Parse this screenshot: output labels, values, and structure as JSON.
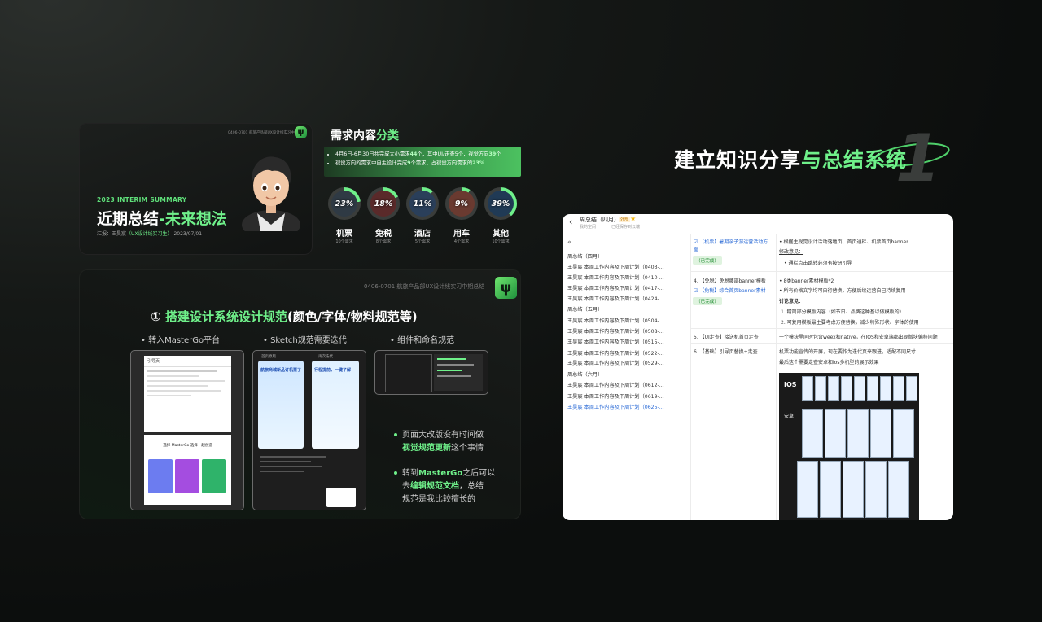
{
  "card1": {
    "small_note": "0406-0701 航旅产品部UX设计线实习中期总结",
    "logo_glyph": "ψ",
    "year_label": "2023 INTERIM SUMMARY",
    "title_main": "近期总结",
    "title_accent": "-未来想法",
    "reporter_prefix": "汇报：王昊宸",
    "reporter_role": "（UX设计线实习生）",
    "reporter_date": "2023/07/01"
  },
  "requirements": {
    "title_main": "需求内容",
    "title_accent": "分类",
    "bullet1_a": "4月6日-6月30日共完成大小需求",
    "bullet1_b": "44",
    "bullet1_c": "个，其中UI/走查5个，视觉方向",
    "bullet1_d": "39",
    "bullet1_e": "个",
    "bullet2_a": "视觉方向的需求中自主设计完成",
    "bullet2_b": "9",
    "bullet2_c": "个需求，占视觉方向需求的",
    "bullet2_d": "23%",
    "categories": [
      {
        "label": "机票",
        "percent": "23%",
        "count": "10个需求",
        "color": "#2f3a44",
        "fill": 0.23
      },
      {
        "label": "免税",
        "percent": "18%",
        "count": "8个需求",
        "color": "#5a2a2a",
        "fill": 0.18
      },
      {
        "label": "酒店",
        "percent": "11%",
        "count": "5个需求",
        "color": "#2a3f5a",
        "fill": 0.11
      },
      {
        "label": "用车",
        "percent": "9%",
        "count": "4个需求",
        "color": "#6a3a30",
        "fill": 0.09
      },
      {
        "label": "其他",
        "percent": "39%",
        "count": "10个需求",
        "color": "#203a55",
        "fill": 0.39
      }
    ]
  },
  "card2": {
    "small_note": "0406-0701 航旅产品部UX设计线实习中期总结",
    "logo_glyph": "ψ",
    "heading_num": "①",
    "heading_green": "搭建设计系统设计规范",
    "heading_rest": "(颜色/字体/物料规范等)",
    "sub1": "• 转入MasterGo平台",
    "sub2": "• Sketch规范需要迭代",
    "sub3": "• 组件和命名规范",
    "shot1_header": "引导页",
    "shot1_banner": "选择 MasterGo 选择一起创造",
    "shot2_tab1": "首页原版",
    "shot2_tab2": "再次迭代",
    "shot2_banner1": "航旅商城新品订机票了",
    "shot2_banner2": "行程提前，一键了解",
    "note1_a": "页面大改版没有时间做",
    "note1_b": "视觉规范更新",
    "note1_c": "这个事情",
    "note2_a": "转到",
    "note2_b": "MasterGo",
    "note2_c": "之后可以",
    "note2_d": "去",
    "note2_e": "编辑规范文档",
    "note2_f": "，总结",
    "note2_g": "规范是我比较擅长的"
  },
  "right": {
    "big_title_main": "建立知识分享",
    "big_title_accent": "与总结系统",
    "big_number": "1"
  },
  "doc": {
    "back_icon": "‹",
    "title": "周总结（四月）",
    "tag": "外部",
    "star": "★",
    "meta1": "我的空间",
    "meta2": "已经保存到云端",
    "collapse_icon": "«",
    "toc": [
      "周总结（四月）",
      "王昊宸 本周工作内容及下周计划（0403-...",
      "王昊宸 本周工作内容及下周计划（0410-...",
      "王昊宸 本周工作内容及下周计划（0417-...",
      "王昊宸 本周工作内容及下周计划（0424-...",
      "周总结（五月）",
      "王昊宸 本周工作内容及下周计划（0504-...",
      "王昊宸 本周工作内容及下周计划（0508-...",
      "王昊宸 本周工作内容及下周计划（0515-...",
      "王昊宸 本周工作内容及下周计划（0522-...",
      "王昊宸 本周工作内容及下周计划（0529-...",
      "周总结（六月）",
      "王昊宸 本周工作内容及下周计划（0612-...",
      "王昊宸 本周工作内容及下周计划（0619-...",
      "王昊宸 本周工作内容及下周计划（0625-..."
    ],
    "task1_line1": "【机票】暑期亲子游运营活动方",
    "task1_line2": "案",
    "done1": "（已完成）",
    "task2a": "4.  【免税】免税腰部banner模板",
    "task2b": "【免税】综合首页banner素材",
    "done2": "（已完成）",
    "task3": "5.  【UI走查】接送机首页走查",
    "task4": "6.  【基础】引导页替换+走查",
    "b1": "根据主视觉设计活动落地页、首页通栏、机票首页banner",
    "b1_sub": "修改意见：",
    "b2": "通栏点击跳转必须有按钮引导",
    "b3": "8类banner素材模版*2",
    "b4": "所有价格文字均可自行替换，方便后续运营自己持续复用",
    "b4_sub": "讨论意见：",
    "b5": "1.  精简部分模版内容（如节日、品牌这种基以做模板的）",
    "b6": "2.  可复用模板最主要考虑方便替换，减少特殊形状、字体的使用",
    "b7": "一个模块里同时包含weex和native，在IOS和安卓端都出现版块偏移问题",
    "b8": "机票功能宣传的开屏，现在要作为迭代页来跟进，适配不同尺寸",
    "b9": "最后这个需要走查安卓和ios多机型的展示效果",
    "phones_ios": "IOS",
    "phones_android": "安卓"
  }
}
